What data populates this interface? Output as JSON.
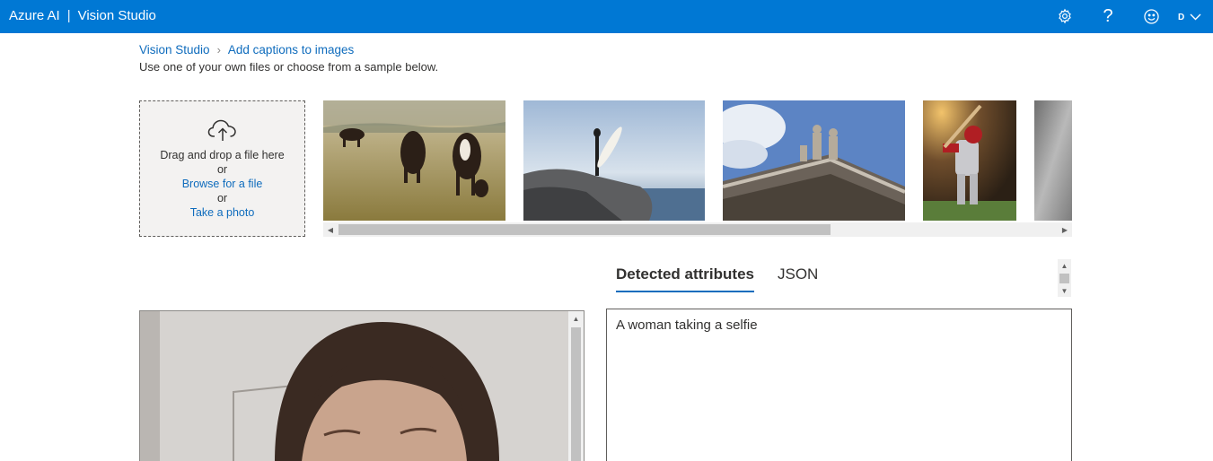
{
  "app": {
    "brand": "Azure AI",
    "separator": "|",
    "product": "Vision Studio"
  },
  "topbar": {
    "settings_icon": "gear-icon",
    "help_label": "?",
    "feedback_icon": "smiley-icon",
    "account_initial": "D"
  },
  "breadcrumb": {
    "home": "Vision Studio",
    "current": "Add captions to images"
  },
  "intro": "Use one of your own files or choose from a sample below.",
  "upload": {
    "drag_text": "Drag and drop a file here",
    "or1": "or",
    "browse_link": "Browse for a file",
    "or2": "or",
    "photo_link": "Take a photo"
  },
  "samples": [
    {
      "name": "cows-in-field"
    },
    {
      "name": "surfer-on-rock"
    },
    {
      "name": "building-statues"
    },
    {
      "name": "baseball-batter"
    },
    {
      "name": "grey-partial"
    }
  ],
  "tabs": [
    {
      "label": "Detected attributes",
      "active": true
    },
    {
      "label": "JSON",
      "active": false
    }
  ],
  "result": {
    "caption": "A woman taking a selfie"
  },
  "colors": {
    "accent": "#0078d4",
    "link": "#0f6cbd"
  }
}
